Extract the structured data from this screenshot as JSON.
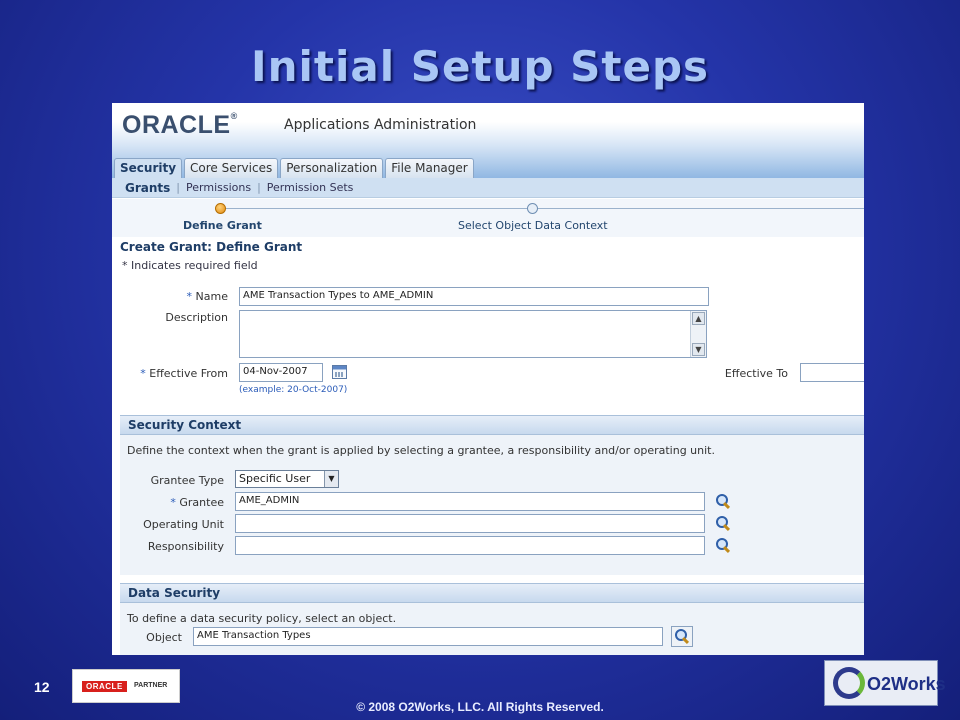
{
  "slide": {
    "title": "Initial Setup Steps",
    "number": "12",
    "copyright": "© 2008 O2Works, LLC. All Rights Reserved.",
    "partner_logo_text": "ORACLE",
    "partner_logo_sub": "PARTNER",
    "company_logo_text": "O2Works"
  },
  "app": {
    "brand": "ORACLE",
    "title": "Applications Administration",
    "tabs": [
      {
        "label": "Security",
        "active": true
      },
      {
        "label": "Core Services",
        "active": false
      },
      {
        "label": "Personalization",
        "active": false
      },
      {
        "label": "File Manager",
        "active": false
      }
    ],
    "subtabs": [
      {
        "label": "Grants",
        "active": true
      },
      {
        "label": "Permissions",
        "active": false
      },
      {
        "label": "Permission Sets",
        "active": false
      }
    ],
    "train": [
      {
        "label": "Define Grant",
        "state": "current"
      },
      {
        "label": "Select Object Data Context",
        "state": "next"
      }
    ]
  },
  "form": {
    "heading": "Create Grant: Define Grant",
    "required_note": "* Indicates required field",
    "name_label": "Name",
    "name_value": "AME Transaction Types to AME_ADMIN",
    "description_label": "Description",
    "description_value": "",
    "effective_from_label": "Effective From",
    "effective_from_value": "04-Nov-2007",
    "effective_from_hint": "(example: 20-Oct-2007)",
    "effective_to_label": "Effective To",
    "effective_to_value": ""
  },
  "security_context": {
    "title": "Security Context",
    "description": "Define the context when the grant is applied by selecting a grantee, a responsibility and/or operating unit.",
    "grantee_type_label": "Grantee Type",
    "grantee_type_value": "Specific User",
    "grantee_label": "Grantee",
    "grantee_value": "AME_ADMIN",
    "operating_unit_label": "Operating Unit",
    "operating_unit_value": "",
    "responsibility_label": "Responsibility",
    "responsibility_value": ""
  },
  "data_security": {
    "title": "Data Security",
    "description": "To define a data security policy, select an object.",
    "object_label": "Object",
    "object_value": "AME Transaction Types"
  },
  "required_marker": "*"
}
